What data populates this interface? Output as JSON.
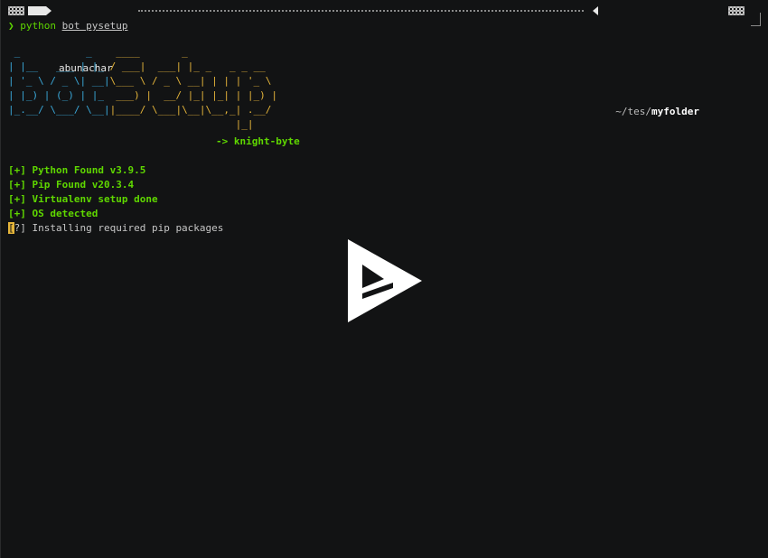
{
  "prompt": {
    "user": "abunachar",
    "path_prefix": "~/tes/",
    "path_folder": "myfolder"
  },
  "command": {
    "arrow": "❯",
    "program": "python",
    "args": "bot pysetup"
  },
  "banner": {
    "bot_lines": [
      " _           _   ",
      "| |__   ___ | |_ ",
      "| '_ \\ / _ \\| __|",
      "| |_) | (_) | |_ ",
      "|_.__/ \\___/ \\__|",
      "                 ",
      "                 "
    ],
    "setup_lines": [
      " ____       _               ",
      "/ ___|  ___| |_ _   _ _ __  ",
      "\\___ \\ / _ \\ __| | | | '_ \\ ",
      " ___) |  __/ |_| |_| | |_) |",
      "|____/ \\___|\\__|\\__,_| .__/ ",
      "                     |_|    ",
      "                            "
    ],
    "author": "-> knight-byte"
  },
  "output": [
    {
      "status": "[+]",
      "text": "Python Found v3.9.5",
      "type": "ok"
    },
    {
      "status": "[+]",
      "text": "Pip Found v20.3.4",
      "type": "ok"
    },
    {
      "status": "[+]",
      "text": "Virtualenv setup done",
      "type": "ok"
    },
    {
      "status": "[+]",
      "text": "OS detected",
      "type": "ok"
    },
    {
      "status": "[?]",
      "text": "Installing required pip packages",
      "type": "pending"
    }
  ],
  "icons": {
    "play": "play-logo-icon",
    "grid": "checker-icon"
  },
  "colors": {
    "background": "#121314",
    "green": "#5fd700",
    "blue": "#3aa7d8",
    "yellow": "#e4b43a"
  }
}
